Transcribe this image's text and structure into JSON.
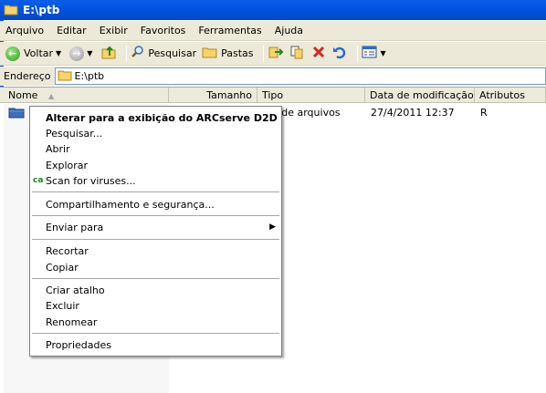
{
  "window": {
    "title": "E:\\ptb"
  },
  "menu": [
    "Arquivo",
    "Editar",
    "Exibir",
    "Favoritos",
    "Ferramentas",
    "Ajuda"
  ],
  "toolbar": {
    "back_label": "Voltar",
    "search_label": "Pesquisar",
    "folders_label": "Pastas"
  },
  "address": {
    "label": "Endereço",
    "value": "E:\\ptb"
  },
  "columns": [
    "Nome",
    "Tamanho",
    "Tipo",
    "Data de modificação",
    "Atributos"
  ],
  "file": {
    "type_partial": "a de arquivos",
    "modified": "27/4/2011 12:37",
    "attributes": "R"
  },
  "context_menu": {
    "items": [
      "Alterar para a exibição do ARCserve D2D",
      "Pesquisar...",
      "Abrir",
      "Explorar",
      "Scan for viruses...",
      "Compartilhamento e segurança...",
      "Enviar para",
      "Recortar",
      "Copiar",
      "Criar atalho",
      "Excluir",
      "Renomear",
      "Propriedades"
    ]
  },
  "colors": {
    "titlebar": "#0054e3",
    "chrome": "#ece9d8",
    "menu_bg": "#ffffff"
  },
  "icons": [
    "folder-icon",
    "back-icon",
    "forward-icon",
    "up-folder-icon",
    "search-icon",
    "folders-icon",
    "move-to-icon",
    "copy-to-icon",
    "delete-icon",
    "undo-icon",
    "views-icon",
    "scan-icon",
    "submenu-arrow-icon"
  ]
}
